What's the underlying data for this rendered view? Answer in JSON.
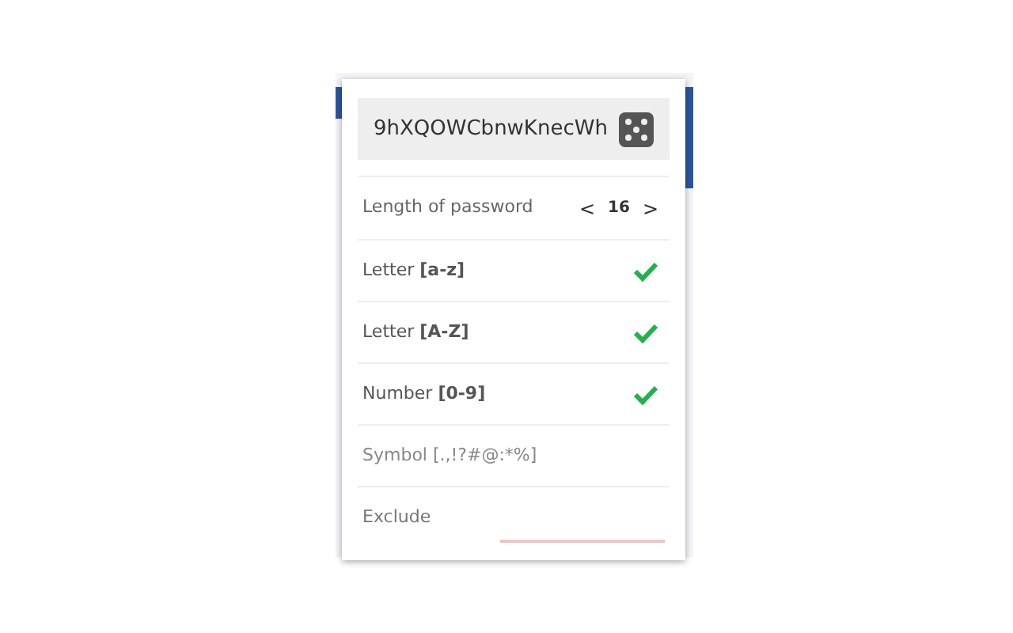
{
  "password": "9hXQOWCbnwKnecWh",
  "length": {
    "label": "Length of password",
    "value": "16",
    "prev": "<",
    "next": ">"
  },
  "options": [
    {
      "label": "Letter **[a-z]**",
      "checked": true
    },
    {
      "label": "Letter **[A-Z]**",
      "checked": true
    },
    {
      "label": "Number **[0-9]**",
      "checked": true
    },
    {
      "label": "Symbol [.,!?#@:*%]",
      "checked": false
    }
  ],
  "exclude": {
    "label": "Exclude"
  }
}
